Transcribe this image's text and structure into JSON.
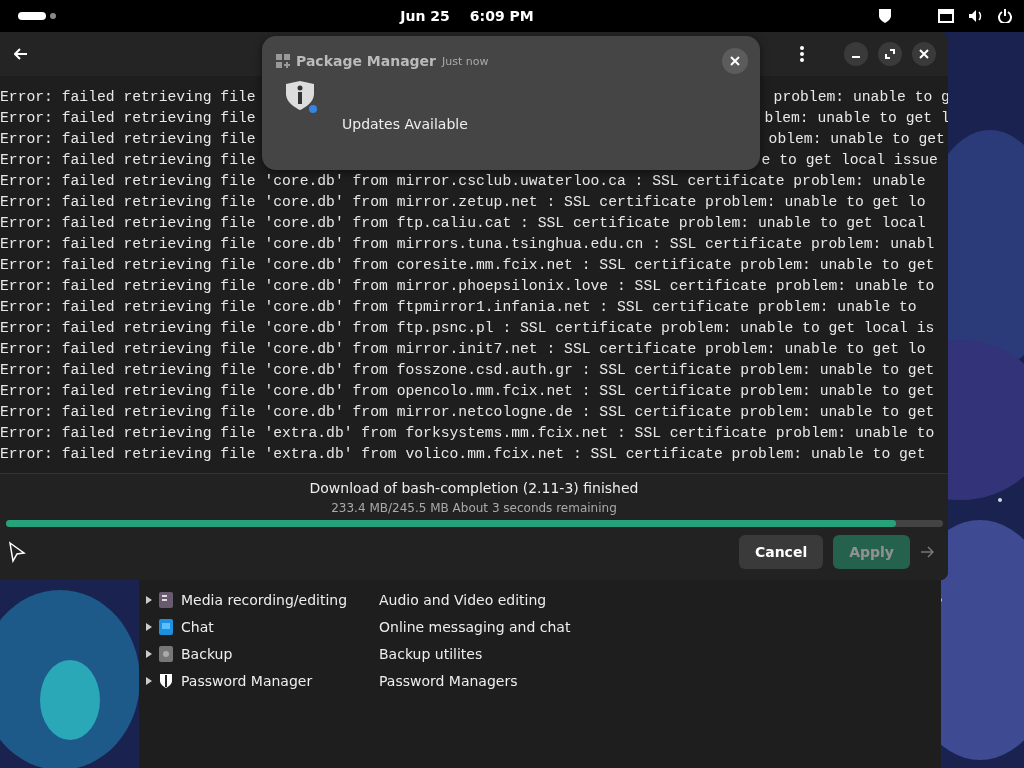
{
  "top_bar": {
    "date": "Jun 25",
    "time": "6:09 PM"
  },
  "notification": {
    "app": "Package Manager",
    "time": "Just now",
    "message": "Updates Available",
    "unread": true
  },
  "log": {
    "covered_lines": [
      {
        "left": "Error: failed retrieving file",
        "right": "problem: unable to g"
      },
      {
        "left": "Error: failed retrieving file",
        "right": "blem: unable to get l"
      },
      {
        "left": "Error: failed retrieving file",
        "right": "oblem: unable to get"
      },
      {
        "left": "Error: failed retrieving file",
        "right": "e to get local issue"
      }
    ],
    "lines": [
      "Error: failed retrieving file 'core.db' from mirror.csclub.uwaterloo.ca : SSL certificate problem: unable",
      "Error: failed retrieving file 'core.db' from mirror.zetup.net : SSL certificate problem: unable to get lo",
      "Error: failed retrieving file 'core.db' from ftp.caliu.cat : SSL certificate problem: unable to get local",
      "Error: failed retrieving file 'core.db' from mirrors.tuna.tsinghua.edu.cn : SSL certificate problem: unabl",
      "Error: failed retrieving file 'core.db' from coresite.mm.fcix.net : SSL certificate problem: unable to get",
      "Error: failed retrieving file 'core.db' from mirror.phoepsilonix.love : SSL certificate problem: unable to",
      "Error: failed retrieving file 'core.db' from ftpmirror1.infania.net : SSL certificate problem: unable to",
      "Error: failed retrieving file 'core.db' from ftp.psnc.pl : SSL certificate problem: unable to get local is",
      "Error: failed retrieving file 'core.db' from mirror.init7.net : SSL certificate problem: unable to get lo",
      "Error: failed retrieving file 'core.db' from fosszone.csd.auth.gr : SSL certificate problem: unable to get",
      "Error: failed retrieving file 'core.db' from opencolo.mm.fcix.net : SSL certificate problem: unable to get",
      "Error: failed retrieving file 'core.db' from mirror.netcologne.de : SSL certificate problem: unable to get",
      "Error: failed retrieving file 'extra.db' from forksystems.mm.fcix.net : SSL certificate problem: unable to",
      "Error: failed retrieving file 'extra.db' from volico.mm.fcix.net : SSL certificate problem: unable to get"
    ]
  },
  "progress": {
    "title": "Download of bash-completion (2.11-3) finished",
    "detail": "233.4 MB/245.5 MB About 3 seconds remaining",
    "level": 0.95
  },
  "buttons": [
    {
      "label": "Cancel",
      "kind": "plain",
      "disabled": false
    },
    {
      "label": "Apply",
      "kind": "suggested",
      "disabled": true
    }
  ],
  "categories": [
    {
      "name": "Media recording/editing",
      "description": "Audio and Video editing",
      "kind": "media",
      "expanded": false
    },
    {
      "name": "Chat",
      "description": "Online messaging and chat",
      "kind": "chat",
      "expanded": false
    },
    {
      "name": "Backup",
      "description": "Backup utilites",
      "kind": "backup",
      "expanded": false
    },
    {
      "name": "Password Manager",
      "description": "Password Managers",
      "kind": "shield",
      "expanded": false
    }
  ]
}
